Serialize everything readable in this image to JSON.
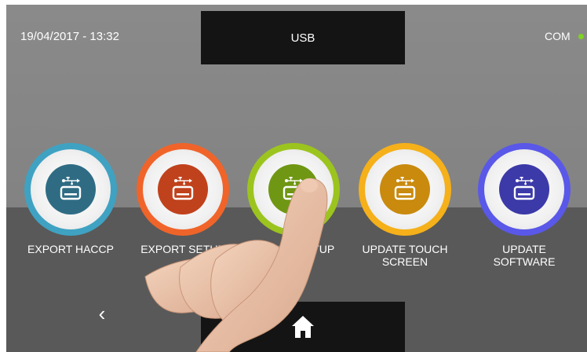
{
  "header": {
    "datetime": "19/04/2017 - 13:32",
    "title": "USB",
    "status_label": "COM",
    "status_color": "#7ed321"
  },
  "buttons": [
    {
      "label_line1": "EXPORT HACCP",
      "label_line2": "",
      "ring_color": "#3fa2c2",
      "core_color": "#2f6c84",
      "icon": "usb-drive-icon"
    },
    {
      "label_line1": "EXPORT SETUP",
      "label_line2": "",
      "ring_color": "#f0642a",
      "core_color": "#c0421c",
      "icon": "usb-drive-icon"
    },
    {
      "label_line1": "IMPORT SETUP",
      "label_line2": "",
      "ring_color": "#9cc41e",
      "core_color": "#6f9713",
      "icon": "usb-drive-icon"
    },
    {
      "label_line1": "UPDATE TOUCH",
      "label_line2": "SCREEN",
      "ring_color": "#f5b01a",
      "core_color": "#c98a0e",
      "icon": "usb-drive-icon"
    },
    {
      "label_line1": "UPDATE",
      "label_line2": "SOFTWARE",
      "ring_color": "#5a58e8",
      "core_color": "#3c3aa8",
      "icon": "usb-drive-icon"
    }
  ],
  "footer": {
    "back_symbol": "‹",
    "home_icon": "home-icon"
  }
}
